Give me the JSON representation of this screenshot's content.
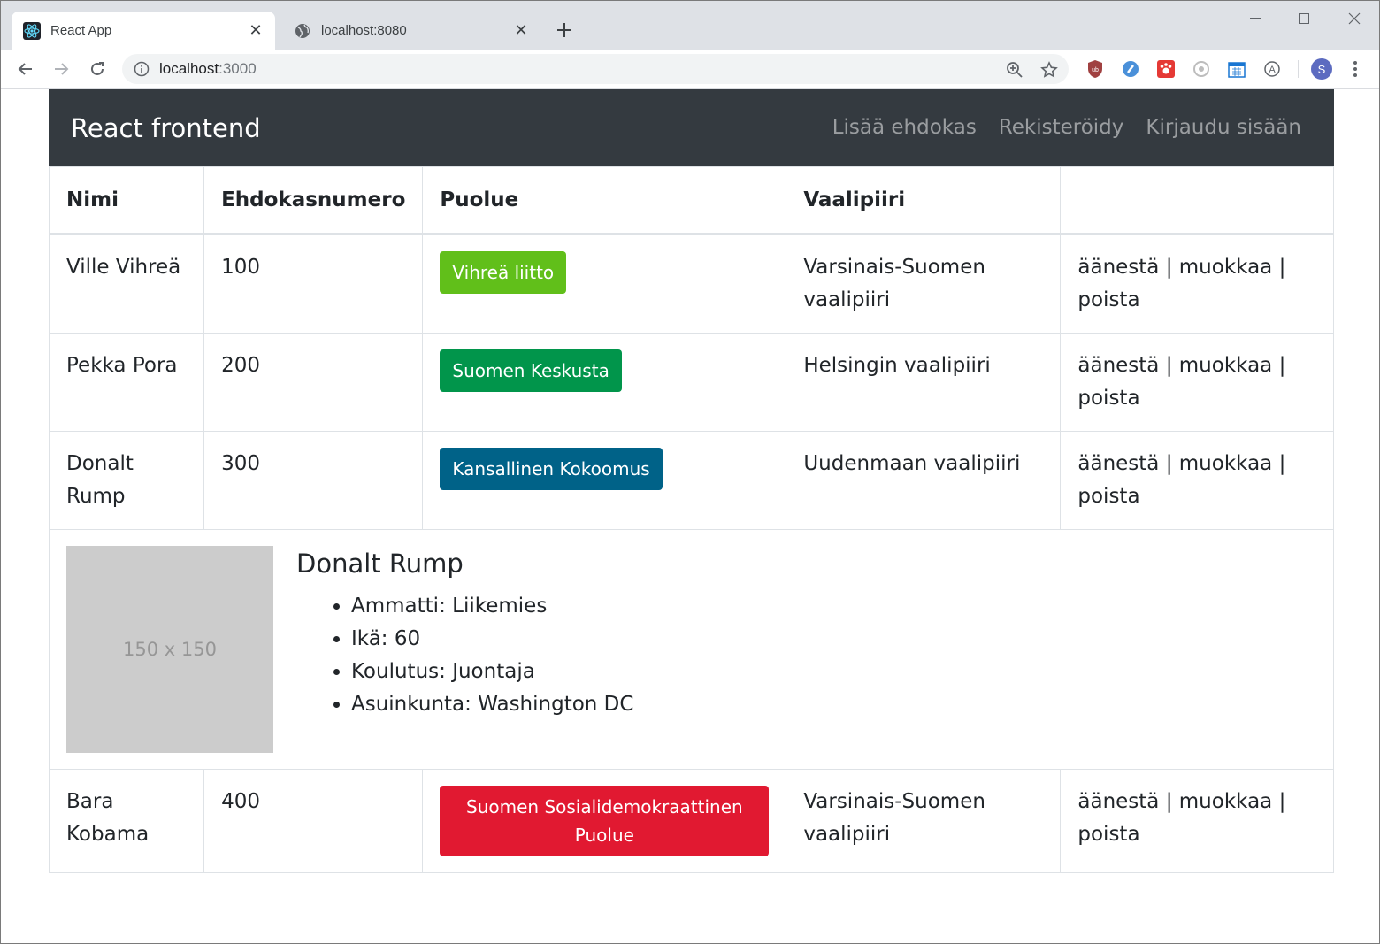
{
  "browser": {
    "tabs": [
      {
        "title": "React App",
        "active": true,
        "icon": "react-icon"
      },
      {
        "title": "localhost:8080",
        "active": false,
        "icon": "globe-icon"
      }
    ],
    "url_host": "localhost",
    "url_port": ":3000",
    "profile_initial": "S"
  },
  "navbar": {
    "brand": "React frontend",
    "links": [
      "Lisää ehdokas",
      "Rekisteröidy",
      "Kirjaudu sisään"
    ]
  },
  "table": {
    "headers": [
      "Nimi",
      "Ehdokasnumero",
      "Puolue",
      "Vaalipiiri",
      ""
    ],
    "rows": [
      {
        "name": "Ville Vihreä",
        "number": "100",
        "party": "Vihreä liitto",
        "party_color": "#61bf1a",
        "district": "Varsinais-Suomen vaalipiiri"
      },
      {
        "name": "Pekka Pora",
        "number": "200",
        "party": "Suomen Keskusta",
        "party_color": "#01954b",
        "district": "Helsingin vaalipiiri"
      },
      {
        "name": "Donalt Rump",
        "number": "300",
        "party": "Kansallinen Kokoomus",
        "party_color": "#006288",
        "district": "Uudenmaan vaalipiiri"
      },
      {
        "name": "Bara Kobama",
        "number": "400",
        "party": "Suomen Sosialidemokraattinen Puolue",
        "party_color": "#e11931",
        "district": "Varsinais-Suomen vaalipiiri"
      }
    ],
    "actions": {
      "vote": "äänestä",
      "sep": " | ",
      "edit": "muokkaa",
      "delete": "poista"
    }
  },
  "detail": {
    "image_placeholder": "150 x 150",
    "name": "Donalt Rump",
    "items": [
      "Ammatti: Liikemies",
      "Ikä: 60",
      "Koulutus: Juontaja",
      "Asuinkunta: Washington DC"
    ]
  }
}
